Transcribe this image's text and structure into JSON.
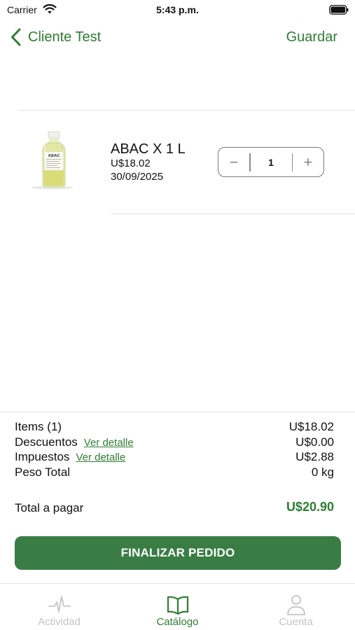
{
  "status_bar": {
    "carrier": "Carrier",
    "time": "5:43 p.m.",
    "icons": [
      "wifi-icon",
      "battery-icon"
    ]
  },
  "nav": {
    "back_label": "Cliente Test",
    "save_label": "Guardar",
    "back_icon": "chevron-left-icon"
  },
  "product": {
    "name": "ABAC X 1 L",
    "price": "U$18.02",
    "date": "30/09/2025",
    "image_label": "ABAC",
    "quantity": "1",
    "minus_symbol": "−",
    "plus_symbol": "+"
  },
  "summary": {
    "items_label": "Items (1)",
    "items_value": "U$18.02",
    "discounts_label": "Descuentos",
    "discounts_link": "Ver detalle",
    "discounts_value": "U$0.00",
    "taxes_label": "Impuestos",
    "taxes_link": "Ver detalle",
    "taxes_value": "U$2.88",
    "weight_label": "Peso Total",
    "weight_value": "0 kg",
    "total_label": "Total a pagar",
    "total_value": "U$20.90"
  },
  "finalize_button": "FINALIZAR PEDIDO",
  "tabs": [
    {
      "label": "Actividad",
      "icon": "activity-pulse-icon",
      "active": false
    },
    {
      "label": "Catálogo",
      "icon": "open-book-icon",
      "active": true
    },
    {
      "label": "Cuenta",
      "icon": "user-icon",
      "active": false
    }
  ],
  "colors": {
    "accent": "#2e7d32",
    "button": "#3a7d44",
    "inactive": "#c4c4c4"
  }
}
